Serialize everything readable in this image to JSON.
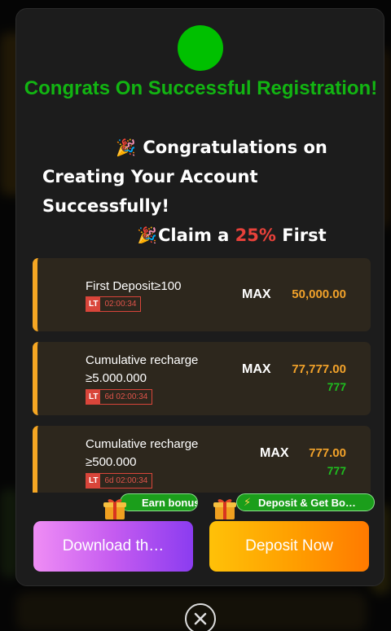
{
  "popup": {
    "title": "Congrats On Successful Registration!",
    "message_line1": "Congratulations on",
    "message_line2": "Creating Your Account Successfully!",
    "message_line3_prefix": "Claim a ",
    "message_line3_highlight": "25%",
    "message_line3_suffix": " First"
  },
  "offers": [
    {
      "title": "First Deposit≥100",
      "badge": "LT",
      "timer": "02:00:34",
      "max_label": "MAX",
      "max_value": "50,000.00",
      "bonus_value": ""
    },
    {
      "title": "Cumulative recharge ≥5.000.000",
      "badge": "LT",
      "timer": "6d 02:00:34",
      "max_label": "MAX",
      "max_value": "77,777.00",
      "bonus_value": "777"
    },
    {
      "title": "Cumulative recharge ≥500.000",
      "badge": "LT",
      "timer": "6d 02:00:34",
      "max_label": "MAX",
      "max_value": "777.00",
      "bonus_value": "777"
    }
  ],
  "actions": {
    "earn_bonus_label": "Earn bonus",
    "deposit_bonus_label": "Deposit & Get Bo…",
    "download_label": "Download th…",
    "deposit_label": "Deposit Now"
  },
  "colors": {
    "title_green": "#12b512",
    "accent_orange": "#f5a623",
    "highlight_red": "#e8413a",
    "download_purple": "#8b3cf0",
    "deposit_orange": "#ff9d00"
  },
  "icons": [
    "party-popper-icon",
    "gift-icon",
    "lightning-icon",
    "close-icon"
  ]
}
